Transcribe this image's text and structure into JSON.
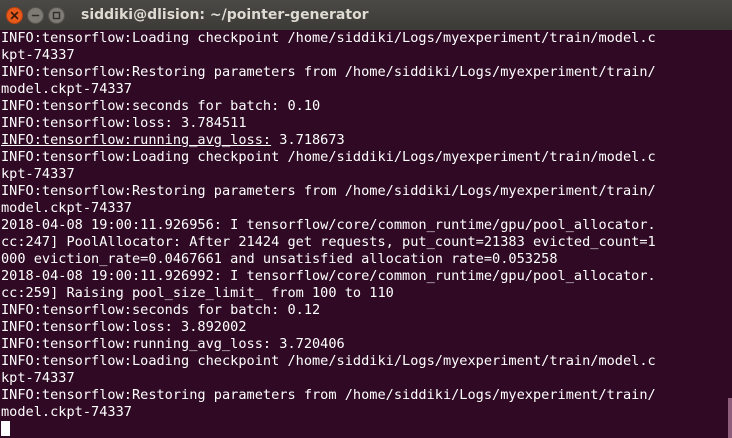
{
  "window": {
    "title": "siddiki@dlision: ~/pointer-generator",
    "buttons": [
      "close-icon",
      "minimize-icon",
      "maximize-icon"
    ]
  },
  "terminal": {
    "lines": [
      "INFO:tensorflow:Loading checkpoint /home/siddiki/Logs/myexperiment/train/model.c",
      "kpt-74337",
      "INFO:tensorflow:Restoring parameters from /home/siddiki/Logs/myexperiment/train/",
      "model.ckpt-74337",
      "INFO:tensorflow:seconds for batch: 0.10",
      "INFO:tensorflow:loss: 3.784511",
      "INFO:tensorflow:running_avg_loss: 3.718673",
      "INFO:tensorflow:Loading checkpoint /home/siddiki/Logs/myexperiment/train/model.c",
      "kpt-74337",
      "INFO:tensorflow:Restoring parameters from /home/siddiki/Logs/myexperiment/train/",
      "model.ckpt-74337",
      "2018-04-08 19:00:11.926956: I tensorflow/core/common_runtime/gpu/pool_allocator.",
      "cc:247] PoolAllocator: After 21424 get requests, put_count=21383 evicted_count=1",
      "000 eviction_rate=0.0467661 and unsatisfied allocation rate=0.053258",
      "2018-04-08 19:00:11.926992: I tensorflow/core/common_runtime/gpu/pool_allocator.",
      "cc:259] Raising pool_size_limit_ from 100 to 110",
      "INFO:tensorflow:seconds for batch: 0.12",
      "INFO:tensorflow:loss: 3.892002",
      "INFO:tensorflow:running_avg_loss: 3.720406",
      "INFO:tensorflow:Loading checkpoint /home/siddiki/Logs/myexperiment/train/model.c",
      "kpt-74337",
      "INFO:tensorflow:Restoring parameters from /home/siddiki/Logs/myexperiment/train/",
      "model.ckpt-74337"
    ],
    "underlined_line": 6,
    "underlined_prefix": "INFO:tensorflow:running_avg_loss:",
    "underlined_rest": " 3.718673"
  },
  "colors": {
    "background": "#300a24",
    "text": "#ffffff",
    "close_button": "#e8591c"
  }
}
